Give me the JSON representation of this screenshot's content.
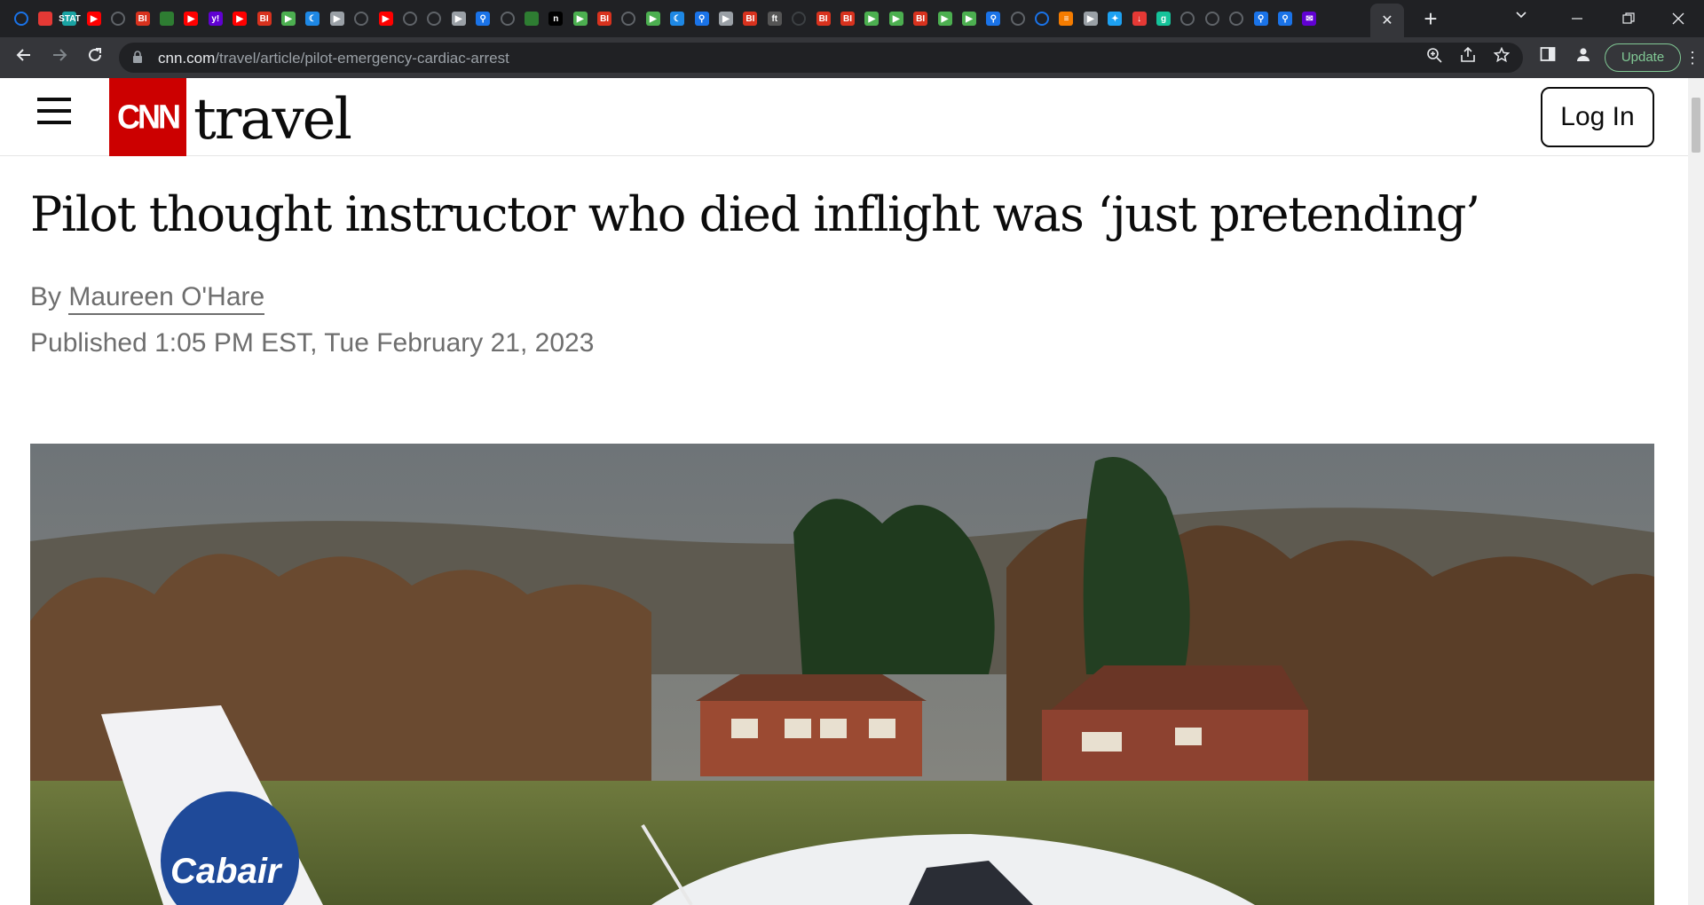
{
  "browser": {
    "tab_favicons": [
      {
        "icon": "globe-icon",
        "color": "#1a73e8",
        "text": ""
      },
      {
        "icon": "pinwheel-icon",
        "color": "#e53935",
        "text": ""
      },
      {
        "icon": "stat-icon",
        "color": "#1aa3a3",
        "text": "STAT"
      },
      {
        "icon": "youtube-icon",
        "color": "#ff0000",
        "text": "▶"
      },
      {
        "icon": "globe-icon",
        "color": "#5f6368",
        "text": ""
      },
      {
        "icon": "bi-icon",
        "color": "#d8321e",
        "text": "BI"
      },
      {
        "icon": "tree-icon",
        "color": "#2e7d32",
        "text": ""
      },
      {
        "icon": "youtube-icon",
        "color": "#ff0000",
        "text": "▶"
      },
      {
        "icon": "yahoo-icon",
        "color": "#6001d2",
        "text": "y!"
      },
      {
        "icon": "youtube-icon",
        "color": "#ff0000",
        "text": "▶"
      },
      {
        "icon": "bi-icon",
        "color": "#d8321e",
        "text": "BI"
      },
      {
        "icon": "play-icon",
        "color": "#4caf50",
        "text": "▶"
      },
      {
        "icon": "moon-icon",
        "color": "#1e88e5",
        "text": "☾"
      },
      {
        "icon": "forward-icon",
        "color": "#9aa0a6",
        "text": "▶"
      },
      {
        "icon": "globe-icon",
        "color": "#5f6368",
        "text": ""
      },
      {
        "icon": "youtube-icon",
        "color": "#ff0000",
        "text": "▶"
      },
      {
        "icon": "globe-icon",
        "color": "#5f6368",
        "text": ""
      },
      {
        "icon": "globe-icon",
        "color": "#5f6368",
        "text": ""
      },
      {
        "icon": "forward-icon",
        "color": "#9aa0a6",
        "text": "▶"
      },
      {
        "icon": "search-icon",
        "color": "#1a73e8",
        "text": "⚲"
      },
      {
        "icon": "globe-icon",
        "color": "#5f6368",
        "text": ""
      },
      {
        "icon": "tree-icon",
        "color": "#2e7d32",
        "text": ""
      },
      {
        "icon": "n-icon",
        "color": "#000000",
        "text": "n"
      },
      {
        "icon": "play-icon",
        "color": "#4caf50",
        "text": "▶"
      },
      {
        "icon": "bi-icon",
        "color": "#d8321e",
        "text": "BI"
      },
      {
        "icon": "globe-icon",
        "color": "#5f6368",
        "text": ""
      },
      {
        "icon": "play-icon",
        "color": "#4caf50",
        "text": "▶"
      },
      {
        "icon": "moon-icon",
        "color": "#1e88e5",
        "text": "☾"
      },
      {
        "icon": "search-icon",
        "color": "#1a73e8",
        "text": "⚲"
      },
      {
        "icon": "forward-icon",
        "color": "#9aa0a6",
        "text": "▶"
      },
      {
        "icon": "bi-icon",
        "color": "#d8321e",
        "text": "BI"
      },
      {
        "icon": "ft-icon",
        "color": "#555555",
        "text": "ft"
      },
      {
        "icon": "globe-icon",
        "color": "#3c4043",
        "text": ""
      },
      {
        "icon": "bi-icon",
        "color": "#d8321e",
        "text": "BI"
      },
      {
        "icon": "bi-icon",
        "color": "#d8321e",
        "text": "BI"
      },
      {
        "icon": "play-icon",
        "color": "#4caf50",
        "text": "▶"
      },
      {
        "icon": "play-icon",
        "color": "#4caf50",
        "text": "▶"
      },
      {
        "icon": "bi-icon",
        "color": "#d8321e",
        "text": "BI"
      },
      {
        "icon": "play-icon",
        "color": "#4caf50",
        "text": "▶"
      },
      {
        "icon": "play-icon",
        "color": "#4caf50",
        "text": "▶"
      },
      {
        "icon": "search-icon",
        "color": "#1a73e8",
        "text": "⚲"
      },
      {
        "icon": "globe-icon",
        "color": "#5f6368",
        "text": ""
      },
      {
        "icon": "globe-icon",
        "color": "#1a73e8",
        "text": ""
      },
      {
        "icon": "menu-icon",
        "color": "#f57c00",
        "text": "≡"
      },
      {
        "icon": "forward-icon",
        "color": "#9aa0a6",
        "text": "▶"
      },
      {
        "icon": "twitter-icon",
        "color": "#1da1f2",
        "text": "✦"
      },
      {
        "icon": "pin-icon",
        "color": "#e53935",
        "text": "↓"
      },
      {
        "icon": "grammarly-icon",
        "color": "#15c39a",
        "text": "g"
      },
      {
        "icon": "globe-icon",
        "color": "#5f6368",
        "text": ""
      },
      {
        "icon": "globe-icon",
        "color": "#5f6368",
        "text": ""
      },
      {
        "icon": "globe-icon",
        "color": "#5f6368",
        "text": ""
      },
      {
        "icon": "search-icon",
        "color": "#1a73e8",
        "text": "⚲"
      },
      {
        "icon": "search-icon",
        "color": "#1a73e8",
        "text": "⚲"
      },
      {
        "icon": "mail-icon",
        "color": "#6001d2",
        "text": "✉"
      }
    ],
    "active_tab_close": "✕",
    "new_tab": "+",
    "url_host": "cnn.com",
    "url_path": "/travel/article/pilot-emergency-cardiac-arrest",
    "update_label": "Update"
  },
  "site": {
    "brand": "CNN",
    "section": "travel",
    "login_label": "Log In",
    "colors": {
      "brand_red": "#cc0000"
    }
  },
  "article": {
    "headline": "Pilot thought instructor who died inflight was ‘just pretending’",
    "byline_prefix": "By",
    "author": "Maureen O'Hare",
    "published": "Published 1:05 PM EST, Tue February 21, 2023",
    "hero_image_text": "Cabair"
  }
}
